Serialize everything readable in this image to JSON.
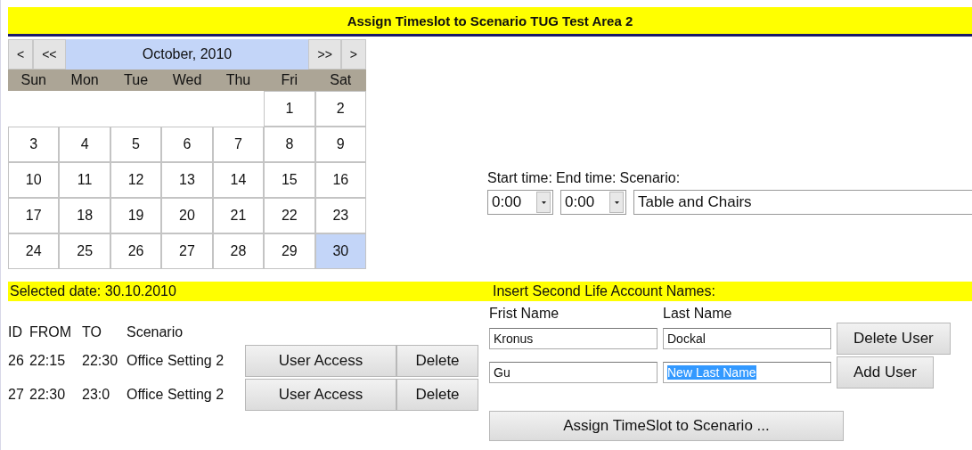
{
  "title": "Assign Timeslot to Scenario TUG Test Area 2",
  "calendar": {
    "nav_left": [
      "<",
      "<<"
    ],
    "month": "October, 2010",
    "nav_right": [
      ">>",
      ">"
    ],
    "weekdays": [
      "Sun",
      "Mon",
      "Tue",
      "Wed",
      "Thu",
      "Fri",
      "Sat"
    ],
    "weeks": [
      [
        {
          "kind": "empty"
        },
        {
          "kind": "empty"
        },
        {
          "kind": "empty"
        },
        {
          "kind": "empty"
        },
        {
          "kind": "empty"
        },
        {
          "kind": "day",
          "label": "1",
          "selected": false
        },
        {
          "kind": "day",
          "label": "2",
          "selected": false
        }
      ],
      [
        {
          "kind": "day",
          "label": "3",
          "selected": false
        },
        {
          "kind": "day",
          "label": "4",
          "selected": false
        },
        {
          "kind": "day",
          "label": "5",
          "selected": false
        },
        {
          "kind": "day",
          "label": "6",
          "selected": false
        },
        {
          "kind": "day",
          "label": "7",
          "selected": false
        },
        {
          "kind": "day",
          "label": "8",
          "selected": false
        },
        {
          "kind": "day",
          "label": "9",
          "selected": false
        }
      ],
      [
        {
          "kind": "day",
          "label": "10",
          "selected": false
        },
        {
          "kind": "day",
          "label": "11",
          "selected": false
        },
        {
          "kind": "day",
          "label": "12",
          "selected": false
        },
        {
          "kind": "day",
          "label": "13",
          "selected": false
        },
        {
          "kind": "day",
          "label": "14",
          "selected": false
        },
        {
          "kind": "day",
          "label": "15",
          "selected": false
        },
        {
          "kind": "day",
          "label": "16",
          "selected": false
        }
      ],
      [
        {
          "kind": "day",
          "label": "17",
          "selected": false
        },
        {
          "kind": "day",
          "label": "18",
          "selected": false
        },
        {
          "kind": "day",
          "label": "19",
          "selected": false
        },
        {
          "kind": "day",
          "label": "20",
          "selected": false
        },
        {
          "kind": "day",
          "label": "21",
          "selected": false
        },
        {
          "kind": "day",
          "label": "22",
          "selected": false
        },
        {
          "kind": "day",
          "label": "23",
          "selected": false
        }
      ],
      [
        {
          "kind": "day",
          "label": "24",
          "selected": false
        },
        {
          "kind": "day",
          "label": "25",
          "selected": false
        },
        {
          "kind": "day",
          "label": "26",
          "selected": false
        },
        {
          "kind": "day",
          "label": "27",
          "selected": false
        },
        {
          "kind": "day",
          "label": "28",
          "selected": false
        },
        {
          "kind": "day",
          "label": "29",
          "selected": false
        },
        {
          "kind": "day",
          "label": "30",
          "selected": true
        }
      ]
    ]
  },
  "timeslot": {
    "start_label": "Start time:",
    "start_value": "0:00",
    "end_label": "End time:",
    "end_value": "0:00",
    "scenario_label": "Scenario:",
    "scenario_value": "Table and Chairs"
  },
  "selected_date": "Selected date: 30.10.2010",
  "slots": {
    "columns": [
      "ID",
      "FROM",
      "TO",
      "Scenario"
    ],
    "rows": [
      {
        "id": "26",
        "from": "22:15",
        "to": "22:30",
        "scenario": "Office Setting 2",
        "access_button": "User Access",
        "delete_button": "Delete"
      },
      {
        "id": "27",
        "from": "22:30",
        "to": "23:0",
        "scenario": "Office Setting 2",
        "access_button": "User Access",
        "delete_button": "Delete"
      }
    ]
  },
  "accounts": {
    "heading": "Insert Second Life Account Names:",
    "first_label": "Frist Name",
    "last_label": "Last Name",
    "rows": [
      {
        "first": "Kronus",
        "last": "Dockal",
        "last_highlighted": false,
        "button": "Delete User"
      },
      {
        "first": "Gu",
        "last": "New Last Name",
        "last_highlighted": true,
        "button": "Add User"
      }
    ]
  },
  "assign_button": "Assign TimeSlot to Scenario ..."
}
